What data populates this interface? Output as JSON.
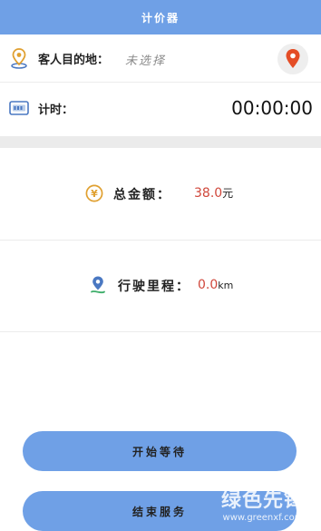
{
  "header": {
    "title": "计价器"
  },
  "destination": {
    "label": "客人目的地：",
    "value": "未选择"
  },
  "timer": {
    "label": "计时：",
    "value": "00:00:00"
  },
  "total": {
    "label": "总金额：",
    "amount": "38.0",
    "unit": "元"
  },
  "mileage": {
    "label": "行驶里程：",
    "distance": "0.0",
    "unit": "km"
  },
  "actions": {
    "start_wait": "开始等待",
    "end_service": "结束服务"
  },
  "watermark": {
    "brand": "绿色先锋",
    "url": "www.greenxf.com"
  },
  "icons": {
    "destination": "location-pin-icon",
    "locate": "map-marker-icon",
    "timer": "digital-clock-icon",
    "total": "yuan-coin-icon",
    "mileage": "route-pin-icon"
  },
  "colors": {
    "accent": "#6fa0e6",
    "amount": "#d0473b",
    "marker": "#e44d26"
  }
}
